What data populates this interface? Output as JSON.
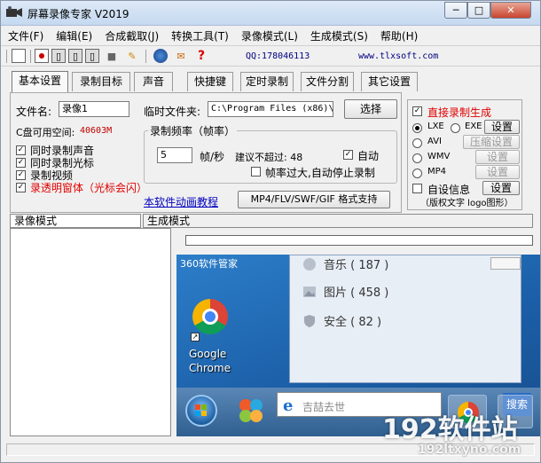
{
  "window": {
    "title": "屏幕录像专家 V2019"
  },
  "menu": [
    "文件(F)",
    "编辑(E)",
    "合成截取(J)",
    "转换工具(T)",
    "录像模式(L)",
    "生成模式(S)",
    "帮助(H)"
  ],
  "toolbar": {
    "qq": "QQ:178046113",
    "site": "www.tlxsoft.com"
  },
  "tabs": [
    "基本设置",
    "录制目标",
    "声音",
    "快捷键",
    "定时录制",
    "文件分割",
    "其它设置"
  ],
  "basic": {
    "filename_label": "文件名:",
    "filename_value": "录像1",
    "tempdir_label": "临时文件夹:",
    "tempdir_value": "C:\\Program Files (x86)\\",
    "select_button": "选择",
    "disk_label": "C盘可用空间:",
    "disk_value": "40603M",
    "checks": [
      {
        "label": "同时录制声音",
        "checked": true
      },
      {
        "label": "同时录制光标",
        "checked": true
      },
      {
        "label": "录制视频",
        "checked": true
      },
      {
        "label": "录透明窗体（光标会闪）",
        "checked": true
      }
    ],
    "freq_title": "录制频率（帧率）",
    "freq_value": "5",
    "freq_unit": "帧/秒",
    "freq_limit": "建议不超过: 48",
    "auto_label": "自动",
    "auto_checked": true,
    "auto_stop_label": "帧率过大,自动停止录制",
    "auto_stop_checked": false,
    "tutorial_link": "本软件动画教程",
    "format_button": "MP4/FLV/SWF/GIF 格式支持"
  },
  "right_panel": {
    "direct_label": "直接录制生成",
    "direct_checked": true,
    "formats": [
      {
        "label": "LXE",
        "selected": true
      },
      {
        "label": "EXE",
        "selected": false
      },
      {
        "label": "AVI",
        "selected": false
      },
      {
        "label": "WMV",
        "selected": false
      },
      {
        "label": "MP4",
        "selected": false
      }
    ],
    "setting_label": "设置",
    "compress_label": "压缩设置",
    "custom_info_label": "自设信息",
    "custom_info_checked": false,
    "copyright_note": "（版权文字 logo图形）"
  },
  "mode_tabs": [
    "录像模式",
    "生成模式"
  ],
  "preview": {
    "desktop_title": "360软件管家",
    "shortcut_name": "Google Chrome",
    "library_items": [
      "音乐 ( 187 )",
      "图片 ( 458 )",
      "安全 ( 82 )"
    ],
    "search_placeholder": "吉喆去世",
    "search_button": "搜索"
  },
  "watermark": {
    "main": "192软件站",
    "sub": "192ltxyno.com"
  }
}
